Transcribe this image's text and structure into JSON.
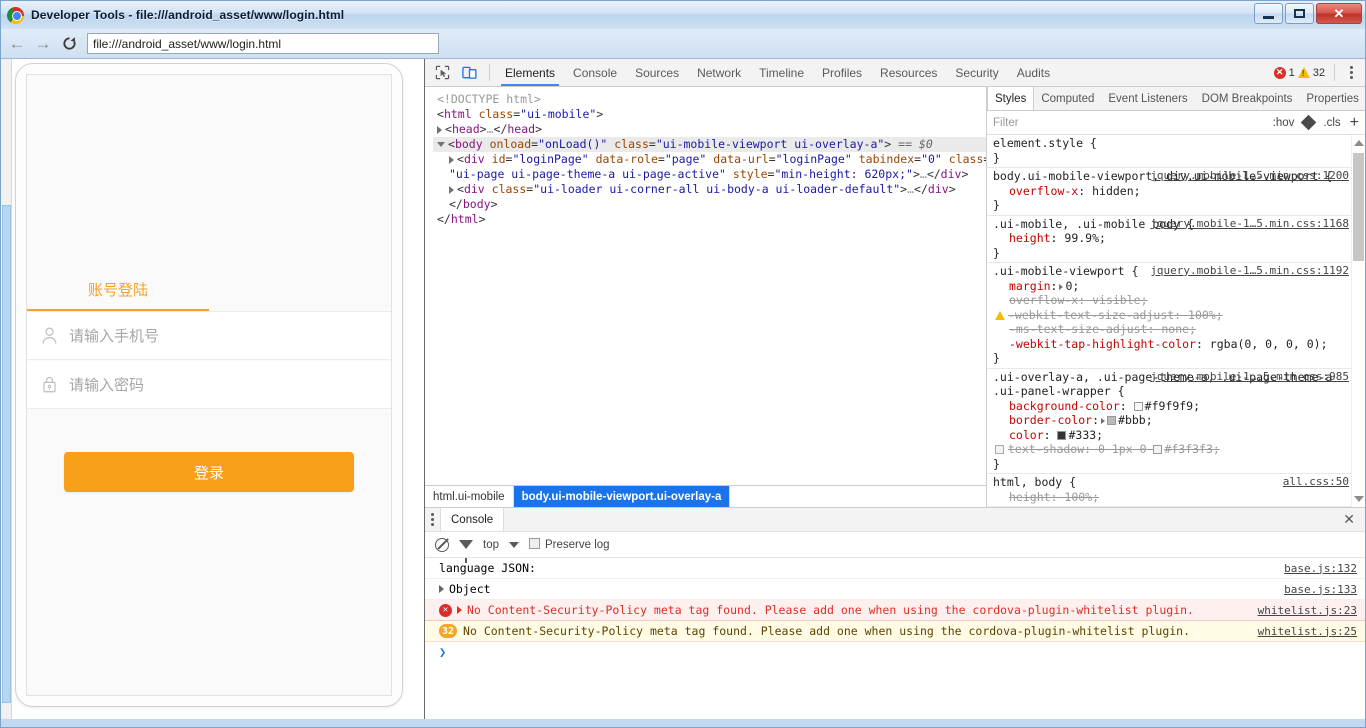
{
  "window": {
    "title": "Developer Tools - file:///android_asset/www/login.html",
    "logo_icon": "chrome-logo-icon",
    "minimize_label": "",
    "maximize_label": "",
    "close_label": "✕"
  },
  "navbar": {
    "back_icon": "←",
    "forward_icon": "→",
    "reload_icon": "⟳",
    "url": "file:///android_asset/www/login.html"
  },
  "page_preview": {
    "tab_label": "账号登陆",
    "phone_field": {
      "icon": "user-icon",
      "placeholder": "请输入手机号",
      "value": ""
    },
    "password_field": {
      "icon": "lock-icon",
      "placeholder": "请输入密码",
      "value": ""
    },
    "login_button": "登录",
    "accent_color": "#f9a01b"
  },
  "devtools": {
    "inspect_icon": "inspect-element-icon",
    "device_icon": "toggle-device-toolbar-icon",
    "tabs": [
      {
        "label": "Elements",
        "active": true
      },
      {
        "label": "Console",
        "active": false
      },
      {
        "label": "Sources",
        "active": false
      },
      {
        "label": "Network",
        "active": false
      },
      {
        "label": "Timeline",
        "active": false
      },
      {
        "label": "Profiles",
        "active": false
      },
      {
        "label": "Resources",
        "active": false
      },
      {
        "label": "Security",
        "active": false
      },
      {
        "label": "Audits",
        "active": false
      }
    ],
    "error_count": "1",
    "warning_count": "32",
    "more_icon": "vertical-dots-icon",
    "dom_tree": [
      {
        "indent": 0,
        "twisty": "none",
        "selected": false,
        "parts": [
          {
            "t": "pt",
            "s": "<!DOCTYPE html>"
          }
        ]
      },
      {
        "indent": 0,
        "twisty": "none",
        "selected": false,
        "parts": [
          {
            "t": "pt",
            "s": "<"
          },
          {
            "t": "tw",
            "s": "html"
          },
          {
            "t": "pt",
            "s": " "
          },
          {
            "t": "at",
            "s": "class"
          },
          {
            "t": "pt",
            "s": "="
          },
          {
            "t": "av",
            "s": "\"ui-mobile\""
          },
          {
            "t": "pt",
            "s": ">"
          }
        ]
      },
      {
        "indent": 0,
        "twisty": "closed",
        "selected": false,
        "parts": [
          {
            "t": "pt",
            "s": "<"
          },
          {
            "t": "tw",
            "s": "head"
          },
          {
            "t": "pt",
            "s": ">"
          },
          {
            "t": "cmt",
            "s": "…"
          },
          {
            "t": "pt",
            "s": "</"
          },
          {
            "t": "tw",
            "s": "head"
          },
          {
            "t": "pt",
            "s": ">"
          }
        ]
      },
      {
        "indent": 0,
        "twisty": "open",
        "selected": true,
        "parts": [
          {
            "t": "pt",
            "s": "<"
          },
          {
            "t": "tw",
            "s": "body"
          },
          {
            "t": "pt",
            "s": " "
          },
          {
            "t": "at",
            "s": "onload"
          },
          {
            "t": "pt",
            "s": "="
          },
          {
            "t": "av",
            "s": "\"onLoad()\""
          },
          {
            "t": "pt",
            "s": " "
          },
          {
            "t": "at",
            "s": "class"
          },
          {
            "t": "pt",
            "s": "="
          },
          {
            "t": "av",
            "s": "\"ui-mobile-viewport ui-overlay-a\""
          },
          {
            "t": "pt",
            "s": ">"
          },
          {
            "t": "dollar",
            "s": "  == $0"
          }
        ]
      },
      {
        "indent": 1,
        "twisty": "closed",
        "selected": false,
        "parts": [
          {
            "t": "pt",
            "s": "<"
          },
          {
            "t": "tw",
            "s": "div"
          },
          {
            "t": "pt",
            "s": " "
          },
          {
            "t": "at",
            "s": "id"
          },
          {
            "t": "pt",
            "s": "="
          },
          {
            "t": "av",
            "s": "\"loginPage\""
          },
          {
            "t": "pt",
            "s": " "
          },
          {
            "t": "at",
            "s": "data-role"
          },
          {
            "t": "pt",
            "s": "="
          },
          {
            "t": "av",
            "s": "\"page\""
          },
          {
            "t": "pt",
            "s": " "
          },
          {
            "t": "at",
            "s": "data-url"
          },
          {
            "t": "pt",
            "s": "="
          },
          {
            "t": "av",
            "s": "\"loginPage\""
          },
          {
            "t": "pt",
            "s": " "
          },
          {
            "t": "at",
            "s": "tabindex"
          },
          {
            "t": "pt",
            "s": "="
          },
          {
            "t": "av",
            "s": "\"0\""
          },
          {
            "t": "pt",
            "s": " "
          },
          {
            "t": "at",
            "s": "class"
          },
          {
            "t": "pt",
            "s": "="
          }
        ]
      },
      {
        "indent": 2,
        "twisty": "none",
        "selected": false,
        "parts": [
          {
            "t": "av",
            "s": "\"ui-page ui-page-theme-a ui-page-active\""
          },
          {
            "t": "pt",
            "s": " "
          },
          {
            "t": "at",
            "s": "style"
          },
          {
            "t": "pt",
            "s": "="
          },
          {
            "t": "av",
            "s": "\"min-height: 620px;\""
          },
          {
            "t": "pt",
            "s": ">"
          },
          {
            "t": "cmt",
            "s": "…"
          },
          {
            "t": "pt",
            "s": "</"
          },
          {
            "t": "tw",
            "s": "div"
          },
          {
            "t": "pt",
            "s": ">"
          }
        ]
      },
      {
        "indent": 1,
        "twisty": "closed",
        "selected": false,
        "parts": [
          {
            "t": "pt",
            "s": "<"
          },
          {
            "t": "tw",
            "s": "div"
          },
          {
            "t": "pt",
            "s": " "
          },
          {
            "t": "at",
            "s": "class"
          },
          {
            "t": "pt",
            "s": "="
          },
          {
            "t": "av",
            "s": "\"ui-loader ui-corner-all ui-body-a ui-loader-default\""
          },
          {
            "t": "pt",
            "s": ">"
          },
          {
            "t": "cmt",
            "s": "…"
          },
          {
            "t": "pt",
            "s": "</"
          },
          {
            "t": "tw",
            "s": "div"
          },
          {
            "t": "pt",
            "s": ">"
          }
        ]
      },
      {
        "indent": 1,
        "twisty": "none",
        "selected": false,
        "parts": [
          {
            "t": "pt",
            "s": "</"
          },
          {
            "t": "tw",
            "s": "body"
          },
          {
            "t": "pt",
            "s": ">"
          }
        ]
      },
      {
        "indent": 0,
        "twisty": "none",
        "selected": false,
        "parts": [
          {
            "t": "pt",
            "s": "</"
          },
          {
            "t": "tw",
            "s": "html"
          },
          {
            "t": "pt",
            "s": ">"
          }
        ]
      }
    ],
    "breadcrumbs": [
      {
        "label": "html.ui-mobile",
        "active": false
      },
      {
        "label": "body.ui-mobile-viewport.ui-overlay-a",
        "active": true
      }
    ]
  },
  "styles": {
    "tabs": [
      {
        "label": "Styles",
        "active": true
      },
      {
        "label": "Computed",
        "active": false
      },
      {
        "label": "Event Listeners",
        "active": false
      },
      {
        "label": "DOM Breakpoints",
        "active": false
      },
      {
        "label": "Properties",
        "active": false
      }
    ],
    "filter_placeholder": "Filter",
    "hov_label": ":hov",
    "cls_label": ".cls",
    "plus_label": "+",
    "rules": [
      {
        "selector": "element.style {",
        "origin": "",
        "declarations": [],
        "closing": "}"
      },
      {
        "selector": "body.ui-mobile-viewport, div.ui-mobile-viewport {",
        "selector_dim_from": "div.ui-mobile-viewport {",
        "origin": "jquery.mobile-1…5.min.css:1200",
        "declarations": [
          {
            "prop": "overflow-x",
            "value": "hidden;",
            "struck": false,
            "warn": false
          }
        ],
        "closing": "}"
      },
      {
        "selector": ".ui-mobile, .ui-mobile body {",
        "selector_dim_from": "",
        "origin": "jquery.mobile-1…5.min.css:1168",
        "declarations": [
          {
            "prop": "height",
            "value": "99.9%;",
            "struck": false,
            "warn": false
          }
        ],
        "closing": "}"
      },
      {
        "selector": ".ui-mobile-viewport {",
        "selector_dim_from": "",
        "origin": "jquery.mobile-1…5.min.css:1192",
        "declarations": [
          {
            "prop": "margin",
            "value": "0;",
            "struck": false,
            "warn": false,
            "expandable": true
          },
          {
            "prop": "overflow-x",
            "value": "visible;",
            "struck": true,
            "warn": false
          },
          {
            "prop": "-webkit-text-size-adjust",
            "value": "100%;",
            "struck": true,
            "warn": true
          },
          {
            "prop": "-ms-text-size-adjust",
            "value": "none;",
            "struck": true,
            "warn": false
          },
          {
            "prop": "-webkit-tap-highlight-color",
            "value": "rgba(0, 0, 0, 0);",
            "struck": false,
            "warn": false
          }
        ],
        "closing": "}"
      },
      {
        "selector": ".ui-overlay-a, .ui-page-theme-a, .ui-page-theme-a .ui-panel-wrapper {",
        "selector_dim_from": "",
        "origin": "jquery.mobile-1….5.min.css:985",
        "declarations": [
          {
            "prop": "background-color",
            "value": "#f9f9f9;",
            "struck": false,
            "warn": false,
            "swatch": "#f9f9f9"
          },
          {
            "prop": "border-color",
            "value": "#bbb;",
            "struck": false,
            "warn": false,
            "swatch": "#bbbbbb",
            "expandable": true
          },
          {
            "prop": "color",
            "value": "#333;",
            "struck": false,
            "warn": false,
            "swatch": "#333333"
          },
          {
            "prop": "text-shadow",
            "value": "0 1px 0 #f3f3f3;",
            "struck": true,
            "warn": false,
            "swatch": "#f3f3f3",
            "checkbox": true
          }
        ],
        "closing": "}"
      },
      {
        "selector": "html, body {",
        "selector_dim_from": "",
        "origin": "all.css:50",
        "declarations": [
          {
            "prop": "height",
            "value": "100%;",
            "struck": true,
            "warn": false
          }
        ],
        "closing": ""
      }
    ]
  },
  "drawer": {
    "more_icon": "vertical-dots-icon",
    "tab_label": "Console",
    "close_label": "✕",
    "clear_icon": "clear-console-icon",
    "filter_icon": "filter-icon",
    "context_label": "top",
    "context_caret": "caret-down-icon",
    "preserve_log_label": "Preserve log",
    "preserve_log_checked": false,
    "entries": [
      {
        "kind": "log",
        "badge": "",
        "expandable": false,
        "message": "language JSON:",
        "source": "base.js:132"
      },
      {
        "kind": "log",
        "badge": "",
        "expandable": true,
        "message": "Object",
        "source": "base.js:133"
      },
      {
        "kind": "error",
        "badge": "!",
        "expandable": true,
        "message": "No Content-Security-Policy meta tag found. Please add one when using the cordova-plugin-whitelist plugin.",
        "source": "whitelist.js:23"
      },
      {
        "kind": "warn",
        "badge": "32",
        "expandable": false,
        "message": "No Content-Security-Policy meta tag found. Please add one when using the cordova-plugin-whitelist plugin.",
        "source": "whitelist.js:25"
      }
    ],
    "prompt_symbol": "❯"
  }
}
